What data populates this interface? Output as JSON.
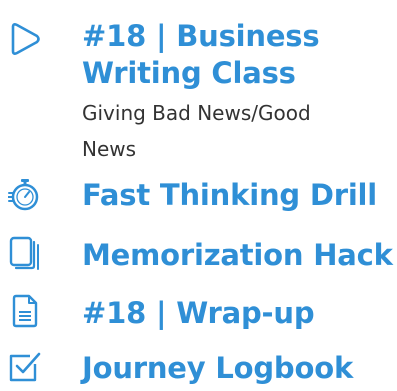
{
  "colors": {
    "accent": "#2f8fd6",
    "text": "#333333",
    "background": "#ffffff"
  },
  "items": [
    {
      "icon": "play-outline-icon",
      "title_line1": "#18 | Business",
      "title_line2": "Writing Class",
      "subtitle_line1": "Giving Bad News/Good",
      "subtitle_line2": "News"
    },
    {
      "icon": "stopwatch-icon",
      "title": "Fast Thinking Drill"
    },
    {
      "icon": "stacked-cards-icon",
      "title": "Memorization Hack"
    },
    {
      "icon": "document-icon",
      "title": "#18 | Wrap-up"
    },
    {
      "icon": "checkbox-icon",
      "title": "Journey Logbook"
    }
  ]
}
